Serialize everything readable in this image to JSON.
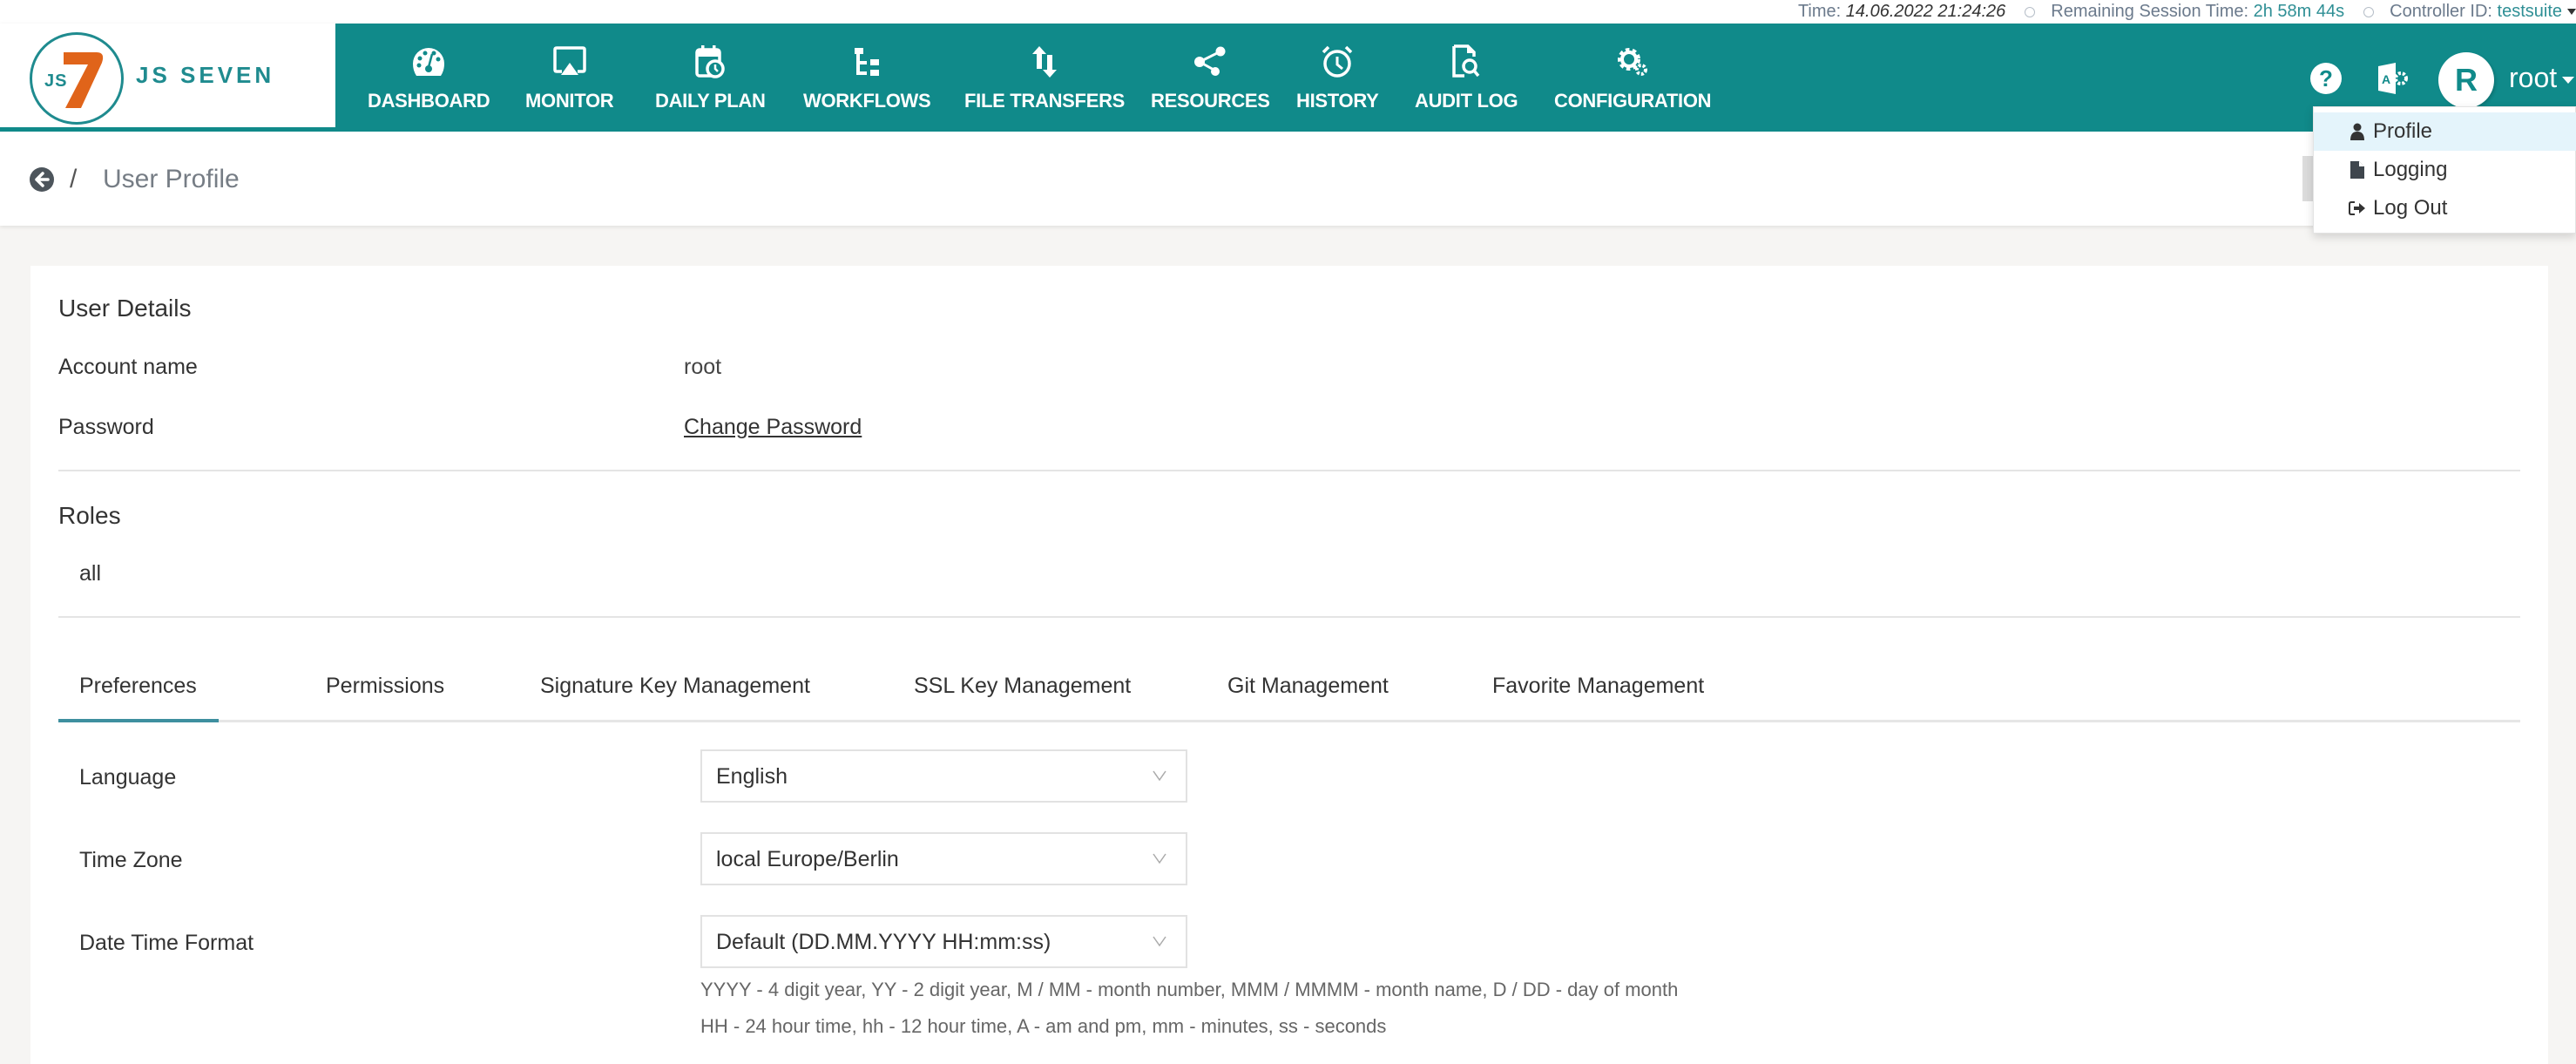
{
  "top_info": {
    "time_label": "Time:",
    "time_value": "14.06.2022 21:24:26",
    "session_label": "Remaining Session Time:",
    "session_value": "2h 58m 44s",
    "controller_label": "Controller ID:",
    "controller_value": "testsuite"
  },
  "brand": {
    "logo_mark": "JS",
    "logo_seven": "7",
    "name": "JS SEVEN",
    "colors": {
      "teal": "#108a8a",
      "orange": "#e0641a"
    }
  },
  "nav": {
    "items": [
      {
        "label": "DASHBOARD",
        "icon": "dashboard-gauge-icon"
      },
      {
        "label": "MONITOR",
        "icon": "monitor-icon"
      },
      {
        "label": "DAILY PLAN",
        "icon": "calendar-clock-icon"
      },
      {
        "label": "WORKFLOWS",
        "icon": "workflow-tree-icon"
      },
      {
        "label": "FILE TRANSFERS",
        "icon": "transfer-arrows-icon"
      },
      {
        "label": "RESOURCES",
        "icon": "share-nodes-icon"
      },
      {
        "label": "HISTORY",
        "icon": "alarm-clock-icon"
      },
      {
        "label": "AUDIT LOG",
        "icon": "file-search-icon"
      },
      {
        "label": "CONFIGURATION",
        "icon": "gears-icon"
      }
    ]
  },
  "header_right": {
    "help_glyph": "?",
    "avatar_initial": "R",
    "username": "root"
  },
  "user_menu": {
    "items": [
      {
        "label": "Profile",
        "icon": "user-icon",
        "active": true
      },
      {
        "label": "Logging",
        "icon": "file-icon",
        "active": false
      },
      {
        "label": "Log Out",
        "icon": "sign-out-icon",
        "active": false
      }
    ]
  },
  "breadcrumb": {
    "separator": "/",
    "title": "User Profile"
  },
  "user_details": {
    "title": "User Details",
    "account_label": "Account name",
    "account_value": "root",
    "password_label": "Password",
    "password_link": "Change Password"
  },
  "roles": {
    "title": "Roles",
    "items": [
      "all"
    ]
  },
  "tabs": [
    {
      "label": "Preferences",
      "active": true
    },
    {
      "label": "Permissions",
      "active": false
    },
    {
      "label": "Signature Key Management",
      "active": false
    },
    {
      "label": "SSL Key Management",
      "active": false
    },
    {
      "label": "Git Management",
      "active": false
    },
    {
      "label": "Favorite Management",
      "active": false
    }
  ],
  "preferences": {
    "language_label": "Language",
    "language_value": "English",
    "timezone_label": "Time Zone",
    "timezone_value": "local Europe/Berlin",
    "datetime_label": "Date Time Format",
    "datetime_value": "Default (DD.MM.YYYY HH:mm:ss)",
    "hint_line1": "YYYY - 4 digit year, YY - 2 digit year, M / MM - month number, MMM / MMMM - month name, D / DD - day of month",
    "hint_line2": "HH - 24 hour time, hh - 12 hour time, A - am and pm, mm - minutes, ss - seconds"
  }
}
